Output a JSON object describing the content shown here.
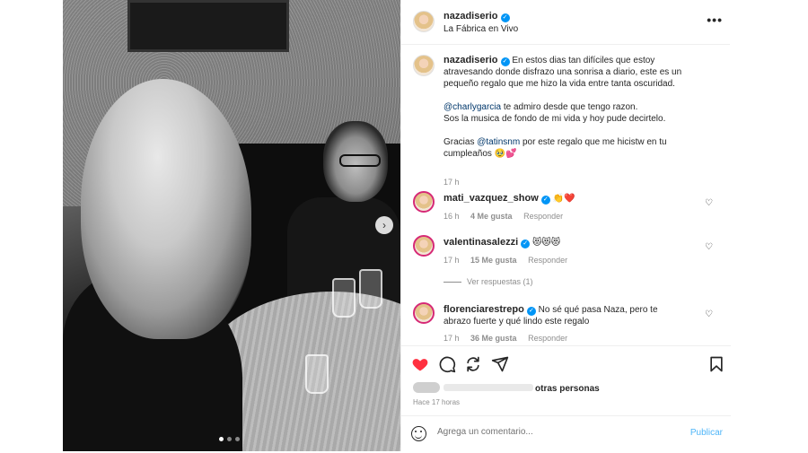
{
  "post": {
    "username": "nazadiserio",
    "location": "La Fábrica en Vivo",
    "caption": {
      "username": "nazadiserio",
      "line1": "En estos dias tan difíciles que estoy atravesando donde disfrazo una sonrisa a diario, este es un pequeño regalo que me hizo la vida entre tanta oscuridad.",
      "mention1": "@charlygarcia",
      "line2": " te admiro desde que tengo razon.",
      "line3": "Sos la musica de fondo de mi vida y hoy pude decirtelo.",
      "line4_pre": "Gracias ",
      "mention2": "@tatinsnm",
      "line4_post": " por este regalo que me hicistw en tu cumpleaños 🥹💕",
      "time": "17 h"
    },
    "comments": [
      {
        "username": "mati_vazquez_show",
        "text": "👏❤️",
        "time": "16 h",
        "likes": "4 Me gusta",
        "reply": "Responder"
      },
      {
        "username": "valentinasalezzi",
        "text": "😻😻😻",
        "time": "17 h",
        "likes": "15 Me gusta",
        "reply": "Responder"
      },
      {
        "username": "florenciarestrepo",
        "text": "No sé qué pasa Naza, pero te abrazo fuerte y qué lindo este regalo",
        "time": "17 h",
        "likes": "36 Me gusta",
        "reply": "Responder"
      }
    ],
    "view_replies": "Ver respuestas (1)",
    "likes_suffix": "otras personas",
    "posted_ago": "Hace 17 horas",
    "comment_placeholder": "Agrega un comentario...",
    "publish_label": "Publicar"
  },
  "icons": {
    "more": "more-options-icon",
    "like": "heart-filled-icon",
    "comment": "comment-icon",
    "share": "share-icon",
    "send": "send-icon",
    "save": "bookmark-icon",
    "emoji": "emoji-icon",
    "next": "chevron-right-icon"
  },
  "colors": {
    "accent": "#0095f6",
    "like": "#ff3040",
    "mention": "#00376b"
  },
  "carousel": {
    "count": 3,
    "active": 1
  }
}
